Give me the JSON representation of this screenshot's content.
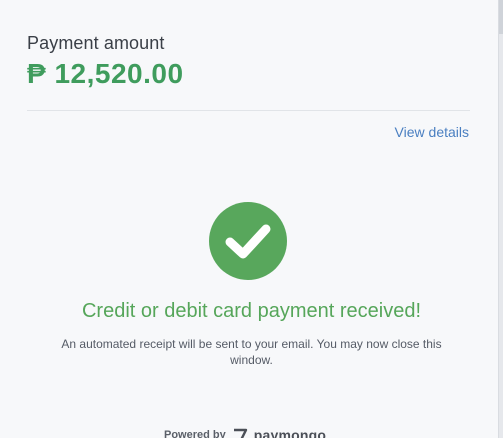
{
  "payment": {
    "label": "Payment amount",
    "amount": "₱ 12,520.00"
  },
  "actions": {
    "view_details": "View details"
  },
  "status": {
    "icon": "check-circle-icon",
    "title": "Credit or debit card payment received!",
    "message": "An automated receipt will be sent to your email. You may now close this window."
  },
  "footer": {
    "powered_by": "Powered by",
    "brand": "paymongo",
    "brand_icon": "paymongo-logo-icon"
  },
  "colors": {
    "amount": "#3f9c5d",
    "success": "#58a75c",
    "link": "#4a7fc1",
    "background": "#f7f8fa"
  }
}
